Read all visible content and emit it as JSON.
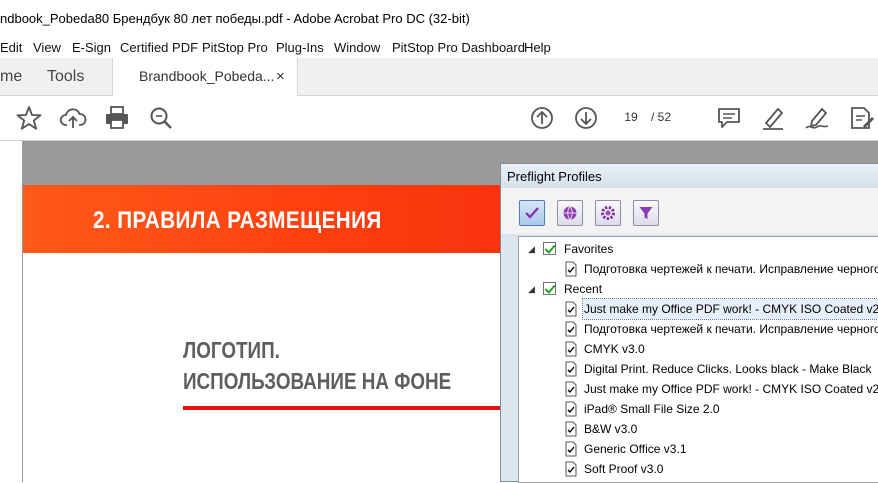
{
  "window": {
    "title": "ndbook_Pobeda80 Брендбук 80 лет победы.pdf - Adobe Acrobat Pro DC (32-bit)"
  },
  "menu": [
    "Edit",
    "View",
    "E-Sign",
    "Certified PDF",
    "PitStop Pro",
    "Plug-Ins",
    "Window",
    "PitStop Pro Dashboard",
    "Help"
  ],
  "tabs": {
    "home": "me",
    "tools": "Tools",
    "document": "Brandbook_Pobeda...",
    "close": "×"
  },
  "toolbar": {
    "page_current": "19",
    "page_total": "/ 52"
  },
  "page": {
    "banner": "2. ПРАВИЛА РАЗМЕЩЕНИЯ",
    "heading_line1": "ЛОГОТИП.",
    "heading_line2": "ИСПОЛЬЗОВАНИЕ НА ФОНЕ"
  },
  "preflight": {
    "title": "Preflight Profiles",
    "groups": [
      {
        "label": "Favorites",
        "items": [
          "Подготовка чертежей к печати. Исправление черного"
        ]
      },
      {
        "label": "Recent",
        "items": [
          "Just make my Office PDF work! - CMYK ISO Coated v2",
          "Подготовка чертежей к печати. Исправление черного",
          "CMYK v3.0",
          "Digital Print. Reduce Clicks. Looks black - Make Black",
          "Just make my Office PDF work! - CMYK ISO Coated v2",
          "iPad® Small File Size 2.0",
          "B&W v3.0",
          "Generic Office v3.1",
          "Soft Proof v3.0"
        ]
      }
    ],
    "selected": "Just make my Office PDF work! - CMYK ISO Coated v2"
  },
  "colors": {
    "banner_start": "#ff5a1a",
    "banner_end": "#ea1a0c",
    "accent_line": "#ee1111",
    "dialog_bg": "#dde6ee"
  }
}
